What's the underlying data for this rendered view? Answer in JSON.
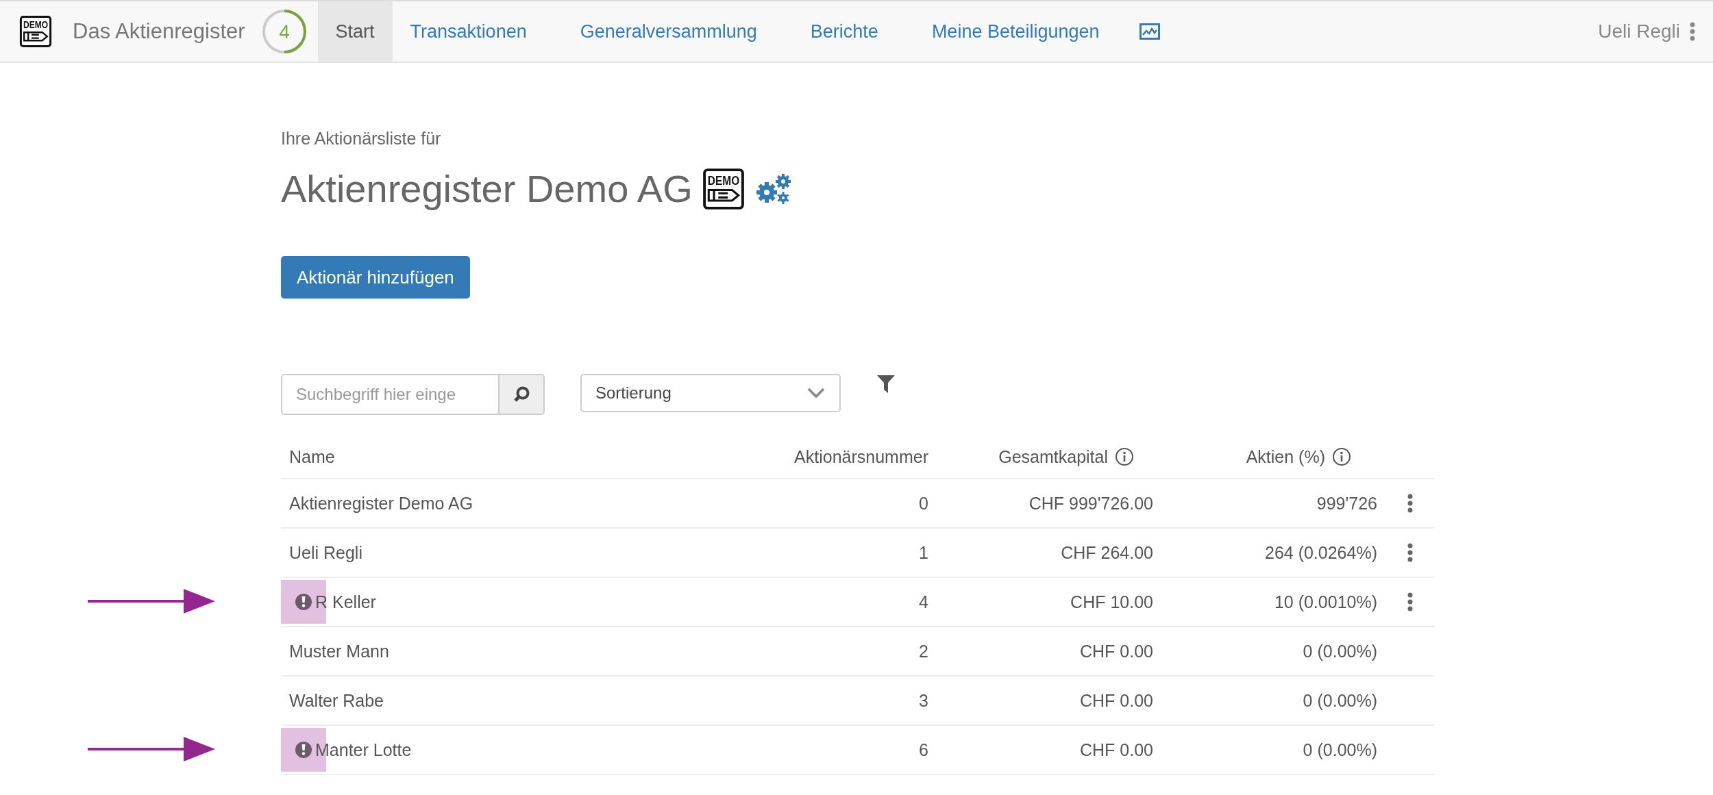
{
  "navbar": {
    "logo_text": "DEMO",
    "brand": "Das Aktienregister",
    "progress": {
      "count": "4",
      "level": 0.5
    },
    "tabs": [
      {
        "label": "Start",
        "selected": true
      },
      {
        "label": "Transaktionen",
        "selected": false
      },
      {
        "label": "Generalversammlung",
        "selected": false
      },
      {
        "label": "Berichte",
        "selected": false
      },
      {
        "label": "Meine Beteiligungen",
        "selected": false
      }
    ],
    "user": "Ueli Regli"
  },
  "header": {
    "subtitle": "Ihre Aktionärsliste für",
    "title": "Aktienregister Demo AG",
    "logo_text": "DEMO"
  },
  "add_button": "Aktionär hinzufügen",
  "search": {
    "placeholder": "Suchbegriff hier einge"
  },
  "sort": {
    "value": "Sortierung"
  },
  "table": {
    "columns": [
      {
        "label": "Name",
        "info": false
      },
      {
        "label": "Aktionärsnummer",
        "info": false
      },
      {
        "label": "Gesamtkapital",
        "info": true
      },
      {
        "label": "Aktien (%)",
        "info": true
      }
    ],
    "rows": [
      {
        "name": "Aktienregister Demo AG",
        "number": "0",
        "capital": "CHF 999'726.00",
        "shares": "999'726",
        "menu": true,
        "flagged": false
      },
      {
        "name": "Ueli Regli",
        "number": "1",
        "capital": "CHF 264.00",
        "shares": "264 (0.0264%)",
        "menu": true,
        "flagged": false
      },
      {
        "name": "R Keller",
        "number": "4",
        "capital": "CHF 10.00",
        "shares": "10 (0.0010%)",
        "menu": true,
        "flagged": true
      },
      {
        "name": "Muster Mann",
        "number": "2",
        "capital": "CHF 0.00",
        "shares": "0 (0.00%)",
        "menu": false,
        "flagged": false
      },
      {
        "name": "Walter Rabe",
        "number": "3",
        "capital": "CHF 0.00",
        "shares": "0 (0.00%)",
        "menu": false,
        "flagged": false
      },
      {
        "name": "Manter Lotte",
        "number": "6",
        "capital": "CHF 0.00",
        "shares": "0 (0.00%)",
        "menu": false,
        "flagged": true
      }
    ]
  }
}
